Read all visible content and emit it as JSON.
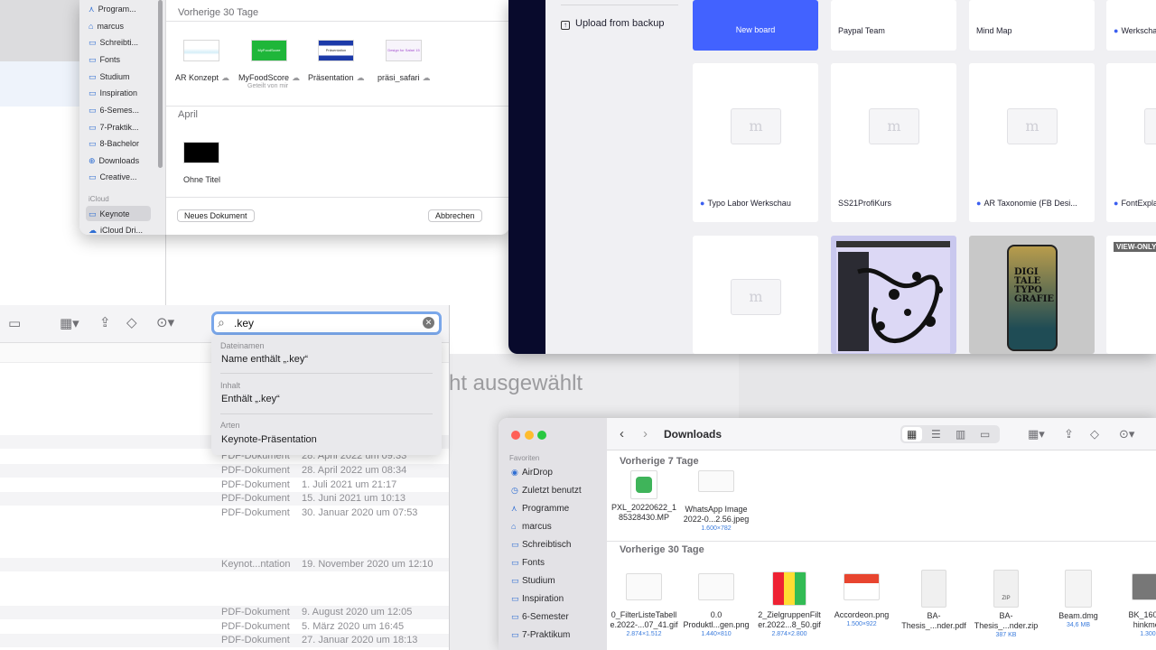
{
  "background_finder": {
    "empty_message": "ht ausgewählt"
  },
  "keynote_chooser": {
    "sidebar_items": [
      "Program...",
      "marcus",
      "Schreibti...",
      "Fonts",
      "Studium",
      "Inspiration",
      "6-Semes...",
      "7-Praktik...",
      "8-Bachelor",
      "Downloads",
      "Creative..."
    ],
    "sidebar_icloud_header": "iCloud",
    "sidebar_icloud_items": [
      "Keynote",
      "iCloud Dri..."
    ],
    "section_recent": "Vorherige 30 Tage",
    "section_april": "April",
    "docs": [
      {
        "name": "AR Konzept",
        "sub": ""
      },
      {
        "name": "MyFoodScore",
        "sub": "Geteilt von mir"
      },
      {
        "name": "Präsentation",
        "sub": ""
      },
      {
        "name": "präsi_safari",
        "sub": ""
      }
    ],
    "april_docs": [
      {
        "name": "Ohne Titel"
      }
    ],
    "thumb_text": {
      "myfoodscore": "MyFoodScore",
      "praesi_safari": "Design for Safari 15",
      "praesentation": "Präsentation"
    },
    "buttons": {
      "new": "Neues Dokument",
      "cancel": "Abbrechen"
    }
  },
  "list_finder": {
    "search": {
      "value": ".key"
    },
    "suggestions": [
      {
        "header": "Dateinamen",
        "item": "Name enthält „.key“"
      },
      {
        "header": "Inhalt",
        "item": "Enthält „.key“"
      },
      {
        "header": "Arten",
        "item": "Keynote-Präsentation"
      }
    ],
    "rows": [
      {
        "kind": "PDF-Dokument",
        "date": "28. April 2022 um 09:33"
      },
      {
        "kind": "PDF-Dokument",
        "date": "28. April 2022 um 08:34"
      },
      {
        "kind": "PDF-Dokument",
        "date": "1. Juli 2021 um 21:17"
      },
      {
        "kind": "PDF-Dokument",
        "date": "15. Juni 2021 um 10:13"
      },
      {
        "kind": "PDF-Dokument",
        "date": "30. Januar 2020 um 07:53"
      },
      {
        "kind": "Keynot...ntation",
        "date": "19. November 2020 um 12:10"
      },
      {
        "kind": "PDF-Dokument",
        "date": "9. August 2020 um 12:05"
      },
      {
        "kind": "PDF-Dokument",
        "date": "5. März 2020 um 16:45"
      },
      {
        "kind": "PDF-Dokument",
        "date": "27. Januar 2020 um 18:13"
      }
    ]
  },
  "miro": {
    "upload_label": "Upload from backup",
    "row1": [
      "New board",
      "Paypal Team",
      "Mind Map",
      "Werkscha"
    ],
    "row2": [
      "Typo Labor Werkschau",
      "SS21ProfiKurs",
      "AR Taxonomie (FB Desi...",
      "FontExpla"
    ],
    "view_only": "VIEW-ONLY",
    "phone_text": "DIGI TALE TYPO GRAFIE",
    "placeholder_glyph": "m"
  },
  "downloads": {
    "title": "Downloads",
    "favorites_header": "Favoriten",
    "favorites": [
      "AirDrop",
      "Zuletzt benutzt",
      "Programme",
      "marcus",
      "Schreibtisch",
      "Fonts",
      "Studium",
      "Inspiration",
      "6-Semester",
      "7-Praktikum"
    ],
    "section_7": "Vorherige 7 Tage",
    "section_30": "Vorherige 30 Tage",
    "files_7": [
      {
        "name1": "PXL_20220622_1",
        "name2": "85328430.MP",
        "size": ""
      },
      {
        "name1": "WhatsApp Image",
        "name2": "2022-0...2.56.jpeg",
        "size": "1.600×782"
      }
    ],
    "files_30": [
      {
        "name1": "0_FilterListeTabell",
        "name2": "e.2022-...07_41.gif",
        "size": "2.874×1.512"
      },
      {
        "name1": "0.0",
        "name2": "Produktl...gen.png",
        "size": "1.440×810"
      },
      {
        "name1": "2_ZielgruppenFilt",
        "name2": "er.2022...8_50.gif",
        "size": "2.874×2.800"
      },
      {
        "name1": "Accordeon.png",
        "name2": "",
        "size": "1.500×922"
      },
      {
        "name1": "BA-",
        "name2": "Thesis_...nder.pdf",
        "size": ""
      },
      {
        "name1": "BA-",
        "name2": "Thesis_...nder.zip",
        "size": "387 KB"
      },
      {
        "name1": "Beam.dmg",
        "name2": "",
        "size": "34,6 MB"
      },
      {
        "name1": "BK_160704",
        "name2": "hinkmoto",
        "size": "1.300×"
      }
    ],
    "zip_label": "ZIP"
  },
  "colors": {
    "accent": "#4262ff",
    "finder_blue": "#2f6ed3",
    "miro_dark": "#080a2c"
  }
}
